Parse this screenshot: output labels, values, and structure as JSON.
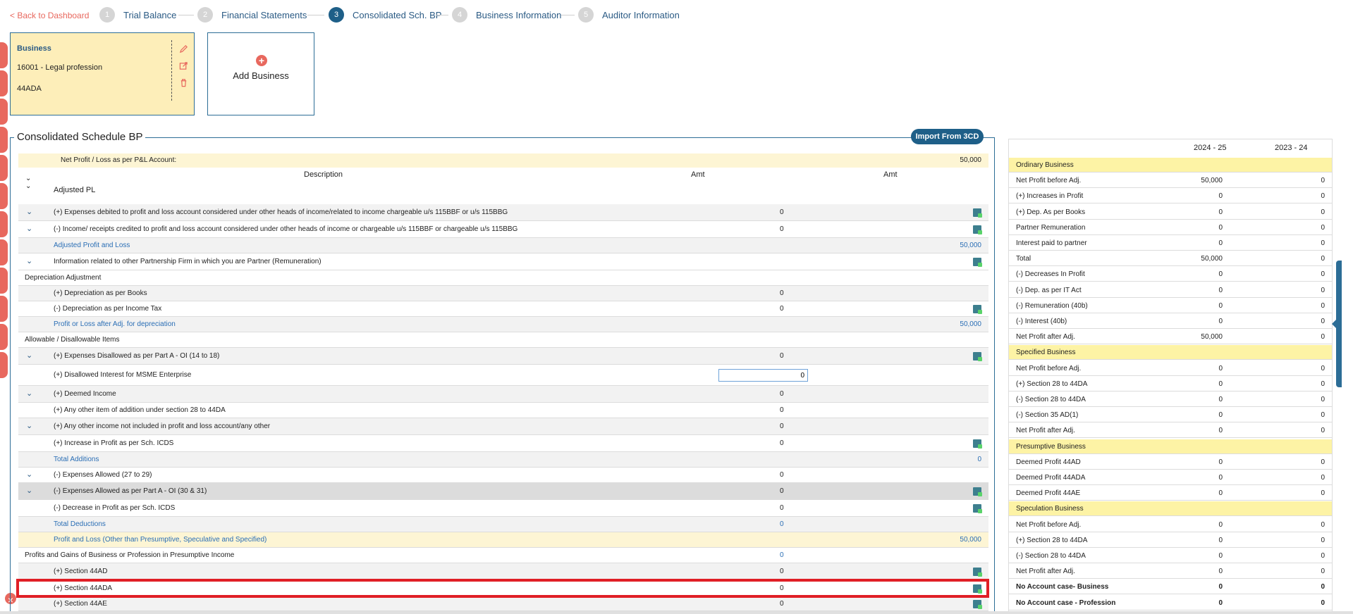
{
  "nav": {
    "back": "< Back to Dashboard",
    "steps": [
      {
        "num": "1",
        "label": "Trial Balance"
      },
      {
        "num": "2",
        "label": "Financial Statements"
      },
      {
        "num": "3",
        "label": "Consolidated Sch. BP"
      },
      {
        "num": "4",
        "label": "Business Information"
      },
      {
        "num": "5",
        "label": "Auditor Information"
      }
    ]
  },
  "business": {
    "title": "Business",
    "code": "16001 - Legal profession",
    "section": "44ADA",
    "add_label": "Add Business"
  },
  "panel": {
    "title": "Consolidated Schedule BP",
    "import": "Import From 3CD",
    "net_profit_label": "Net Profit / Loss as per P&L Account:",
    "net_profit_value": "50,000",
    "col_description": "Description",
    "col_amt1": "Amt",
    "col_amt2": "Amt",
    "adjusted_pl": "Adjusted PL"
  },
  "rows": [
    {
      "desc": "(+) Expenses debited to profit and loss account considered under other heads of income/related to income chargeable u/s 115BBF or u/s 115BBG",
      "amt": "0",
      "amt2": ""
    },
    {
      "desc": "(-) Income/ receipts credited to profit and loss account considered under other heads of income or chargeable u/s 115BBF or chargeable u/s 115BBG",
      "amt": "0",
      "amt2": ""
    },
    {
      "desc": "Adjusted Profit and Loss",
      "amt": "",
      "amt2": "50,000"
    },
    {
      "desc": "Information related to other Partnership Firm in which you are Partner (Remuneration)",
      "amt": "",
      "amt2": ""
    },
    {
      "desc": "Depreciation Adjustment",
      "amt": "",
      "amt2": ""
    },
    {
      "desc": "(+) Depreciation as per Books",
      "amt": "0",
      "amt2": ""
    },
    {
      "desc": "(-) Depreciation as per Income Tax",
      "amt": "0",
      "amt2": ""
    },
    {
      "desc": "Profit or Loss after Adj. for depreciation",
      "amt": "",
      "amt2": "50,000"
    },
    {
      "desc": "Allowable / Disallowable Items",
      "amt": "",
      "amt2": ""
    },
    {
      "desc": "(+) Expenses Disallowed as per Part A - OI (14 to 18)",
      "amt": "0",
      "amt2": ""
    },
    {
      "desc": "(+) Disallowed Interest for MSME Enterprise",
      "amt": "0",
      "amt2": ""
    },
    {
      "desc": "(+) Deemed Income",
      "amt": "0",
      "amt2": ""
    },
    {
      "desc": "(+) Any other item of addition under section 28 to 44DA",
      "amt": "0",
      "amt2": ""
    },
    {
      "desc": "(+) Any other income not included in profit and loss account/any other",
      "amt": "0",
      "amt2": ""
    },
    {
      "desc": "(+) Increase in Profit as per Sch. ICDS",
      "amt": "0",
      "amt2": ""
    },
    {
      "desc": "Total Additions",
      "amt": "",
      "amt2": "0"
    },
    {
      "desc": "(-) Expenses Allowed (27 to 29)",
      "amt": "0",
      "amt2": ""
    },
    {
      "desc": "(-) Expenses Allowed as per Part A - OI (30 & 31)",
      "amt": "0",
      "amt2": ""
    },
    {
      "desc": "(-) Decrease in Profit as per Sch. ICDS",
      "amt": "0",
      "amt2": ""
    },
    {
      "desc": "Total Deductions",
      "amt": "0",
      "amt2": ""
    },
    {
      "desc": "Profit and Loss (Other than Presumptive, Speculative and Specified)",
      "amt": "",
      "amt2": "50,000"
    },
    {
      "desc": "Profits and Gains of Business or Profession in Presumptive Income",
      "amt": "0",
      "amt2": ""
    },
    {
      "desc": "(+) Section 44AD",
      "amt": "0",
      "amt2": ""
    },
    {
      "desc": "(+) Section 44ADA",
      "amt": "0",
      "amt2": ""
    },
    {
      "desc": "(+) Section 44AE",
      "amt": "0",
      "amt2": ""
    }
  ],
  "summary": {
    "col1": "2024 - 25",
    "col2": "2023 - 24",
    "rows": [
      {
        "label": "Ordinary Business",
        "v1": "",
        "v2": ""
      },
      {
        "label": "Net Profit before Adj.",
        "v1": "50,000",
        "v2": "0"
      },
      {
        "label": "(+) Increases in Profit",
        "v1": "0",
        "v2": "0"
      },
      {
        "label": "(+) Dep. As per Books",
        "v1": "0",
        "v2": "0"
      },
      {
        "label": "Partner Remuneration",
        "v1": "0",
        "v2": "0"
      },
      {
        "label": "Interest paid to partner",
        "v1": "0",
        "v2": "0"
      },
      {
        "label": "Total",
        "v1": "50,000",
        "v2": "0"
      },
      {
        "label": "(-) Decreases In Profit",
        "v1": "0",
        "v2": "0"
      },
      {
        "label": "(-) Dep. as per IT Act",
        "v1": "0",
        "v2": "0"
      },
      {
        "label": "(-) Remuneration (40b)",
        "v1": "0",
        "v2": "0"
      },
      {
        "label": "(-) Interest (40b)",
        "v1": "0",
        "v2": "0"
      },
      {
        "label": "Net Profit after Adj.",
        "v1": "50,000",
        "v2": "0"
      },
      {
        "label": "Specified Business",
        "v1": "",
        "v2": ""
      },
      {
        "label": "Net Profit before Adj.",
        "v1": "0",
        "v2": "0"
      },
      {
        "label": "(+) Section 28 to 44DA",
        "v1": "0",
        "v2": "0"
      },
      {
        "label": "(-) Section 28 to 44DA",
        "v1": "0",
        "v2": "0"
      },
      {
        "label": "(-) Section 35 AD(1)",
        "v1": "0",
        "v2": "0"
      },
      {
        "label": "Net Profit after Adj.",
        "v1": "0",
        "v2": "0"
      },
      {
        "label": "Presumptive Business",
        "v1": "",
        "v2": ""
      },
      {
        "label": "Deemed Profit 44AD",
        "v1": "0",
        "v2": "0"
      },
      {
        "label": "Deemed Profit 44ADA",
        "v1": "0",
        "v2": "0"
      },
      {
        "label": "Deemed Profit 44AE",
        "v1": "0",
        "v2": "0"
      },
      {
        "label": "Speculation Business",
        "v1": "",
        "v2": ""
      },
      {
        "label": "Net Profit before Adj.",
        "v1": "0",
        "v2": "0"
      },
      {
        "label": "(+) Section 28 to 44DA",
        "v1": "0",
        "v2": "0"
      },
      {
        "label": "(-) Section 28 to 44DA",
        "v1": "0",
        "v2": "0"
      },
      {
        "label": "Net Profit after Adj.",
        "v1": "0",
        "v2": "0"
      },
      {
        "label": "No Account case- Business",
        "v1": "0",
        "v2": "0"
      },
      {
        "label": "No Account case - Profession",
        "v1": "0",
        "v2": "0"
      }
    ]
  }
}
